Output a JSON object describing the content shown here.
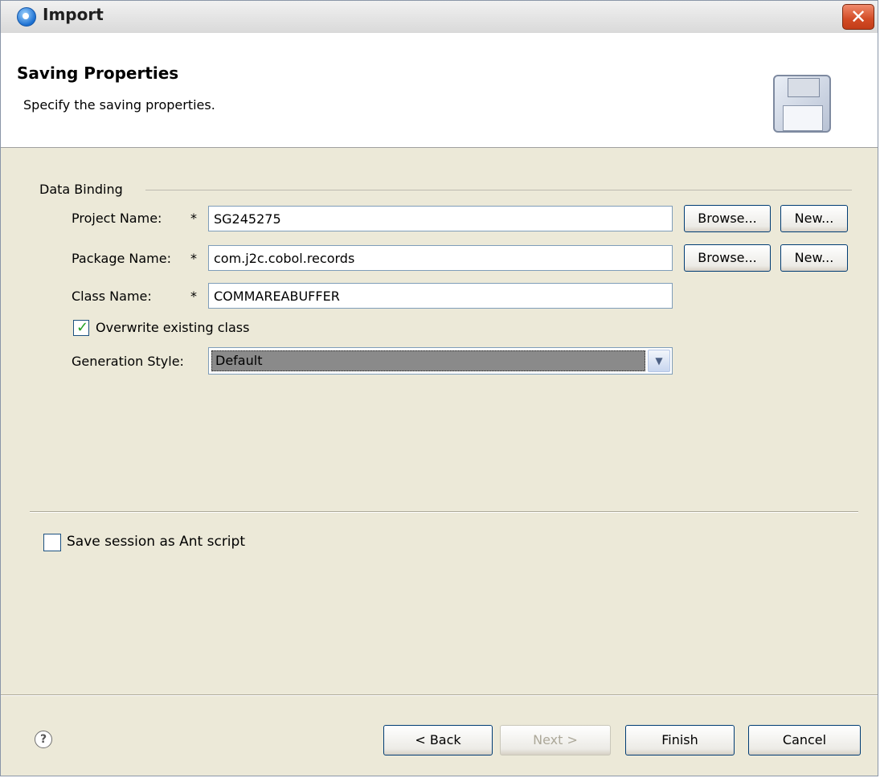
{
  "window": {
    "title": "Import",
    "close_glyph": "✕"
  },
  "header": {
    "title": "Saving Properties",
    "description": "Specify the saving properties.",
    "icon": "floppy-disk-icon"
  },
  "data_binding": {
    "group_label": "Data Binding",
    "required_marker": "*",
    "project": {
      "label": "Project Name:",
      "value": "SG245275",
      "browse_label": "Browse...",
      "new_label": "New..."
    },
    "package": {
      "label": "Package Name:",
      "value": "com.j2c.cobol.records",
      "browse_label": "Browse...",
      "new_label": "New..."
    },
    "class": {
      "label": "Class Name:",
      "value": "COMMAREABUFFER"
    },
    "overwrite": {
      "label": "Overwrite existing class",
      "checked": true
    },
    "generation_style": {
      "label": "Generation Style:",
      "selected": "Default"
    }
  },
  "ant_script": {
    "label": "Save session as Ant script",
    "checked": false
  },
  "footer": {
    "help_icon": "help-icon",
    "back_label": "< Back",
    "next_label": "Next >",
    "finish_label": "Finish",
    "cancel_label": "Cancel"
  }
}
